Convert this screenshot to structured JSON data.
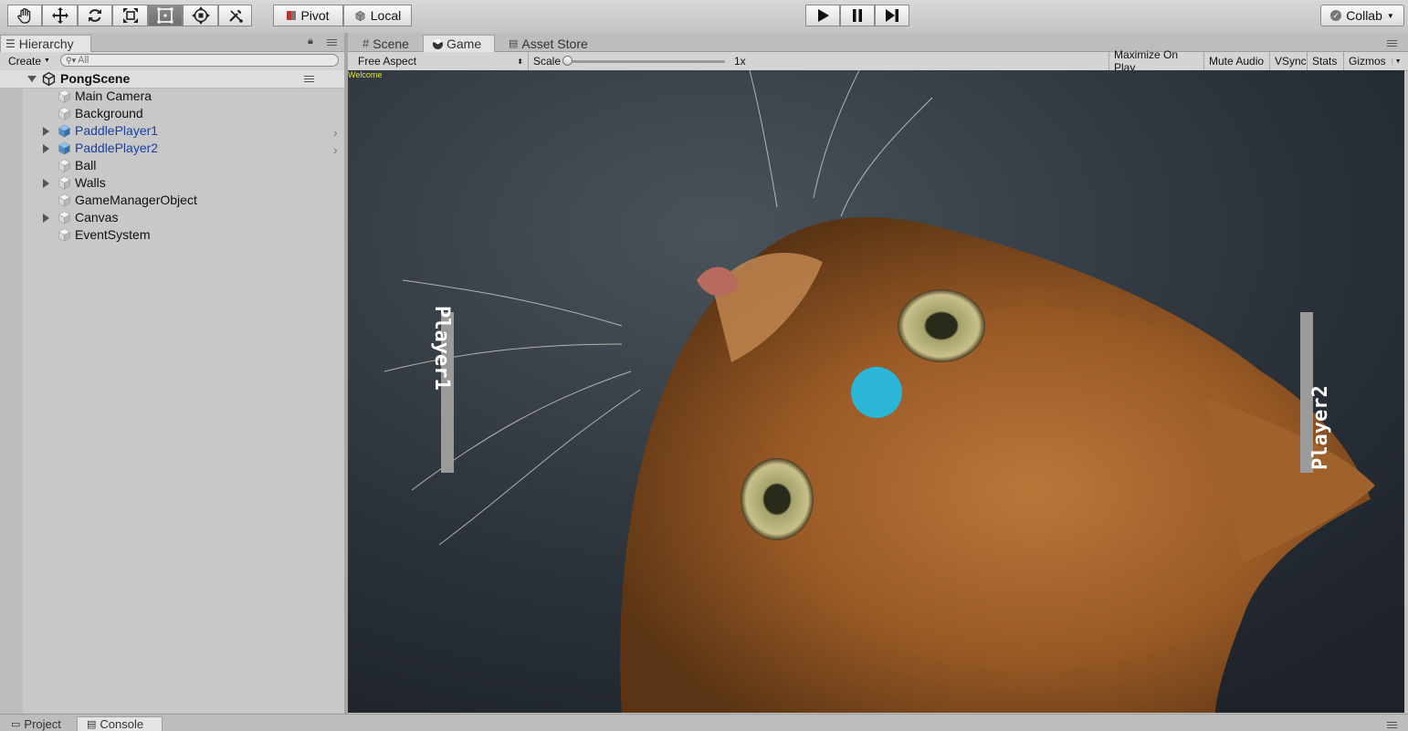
{
  "toolbar": {
    "tools": [
      "hand-tool",
      "move-tool",
      "rotate-tool",
      "scale-tool",
      "rect-tool",
      "transform-tool",
      "custom-tool"
    ],
    "selected_tool": "rect-tool",
    "pivot_label": "Pivot",
    "local_label": "Local",
    "collab_label": "Collab"
  },
  "hierarchy": {
    "tab_label": "Hierarchy",
    "create_label": "Create",
    "search_placeholder": "All",
    "scene_name": "PongScene",
    "items": [
      {
        "name": "Main Camera",
        "foldable": false,
        "prefab": false
      },
      {
        "name": "Background",
        "foldable": false,
        "prefab": false
      },
      {
        "name": "PaddlePlayer1",
        "foldable": true,
        "prefab": true
      },
      {
        "name": "PaddlePlayer2",
        "foldable": true,
        "prefab": true
      },
      {
        "name": "Ball",
        "foldable": false,
        "prefab": false
      },
      {
        "name": "Walls",
        "foldable": true,
        "prefab": false
      },
      {
        "name": "GameManagerObject",
        "foldable": false,
        "prefab": false
      },
      {
        "name": "Canvas",
        "foldable": true,
        "prefab": false
      },
      {
        "name": "EventSystem",
        "foldable": false,
        "prefab": false
      }
    ]
  },
  "main_tabs": {
    "scene": "Scene",
    "game": "Game",
    "asset_store": "Asset Store"
  },
  "game_bar": {
    "aspect": "Free Aspect",
    "scale_label": "Scale",
    "scale_value": "1x",
    "maximize": "Maximize On Play",
    "mute": "Mute Audio",
    "vsync": "VSync",
    "stats": "Stats",
    "gizmos": "Gizmos"
  },
  "game": {
    "welcome": "Welcome",
    "player1": "Player1",
    "player2": "Player2",
    "ball_color": "#2bb5d6"
  },
  "bottom_tabs": {
    "project": "Project",
    "console": "Console"
  }
}
